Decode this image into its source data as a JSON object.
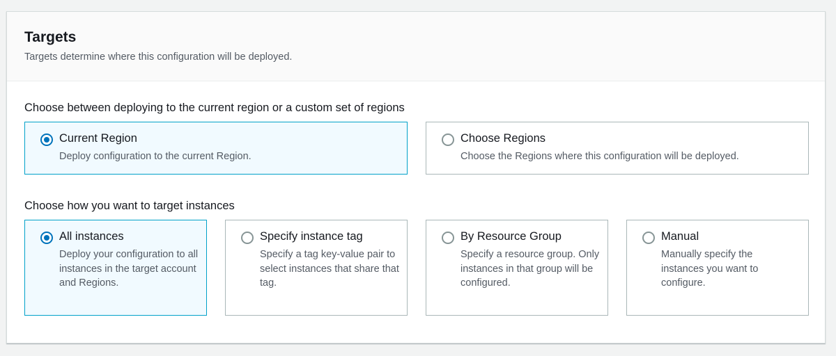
{
  "panel": {
    "title": "Targets",
    "description": "Targets determine where this configuration will be deployed."
  },
  "region_section": {
    "label": "Choose between deploying to the current region or a custom set of regions",
    "options": [
      {
        "title": "Current Region",
        "description": "Deploy configuration to the current Region.",
        "selected": true
      },
      {
        "title": "Choose Regions",
        "description": "Choose the Regions where this configuration will be deployed.",
        "selected": false
      }
    ]
  },
  "instance_section": {
    "label": "Choose how you want to target instances",
    "options": [
      {
        "title": "All instances",
        "description": "Deploy your configuration to all instances in the target account and Regions.",
        "selected": true
      },
      {
        "title": "Specify instance tag",
        "description": "Specify a tag key-value pair to select instances that share that tag.",
        "selected": false
      },
      {
        "title": "By Resource Group",
        "description": "Specify a resource group. Only instances in that group will be configured.",
        "selected": false
      },
      {
        "title": "Manual",
        "description": "Manually specify the instances you want to configure.",
        "selected": false
      }
    ]
  },
  "colors": {
    "accent": "#0073bb",
    "selected_border": "#00a1c9",
    "selected_background": "#f1faff"
  }
}
